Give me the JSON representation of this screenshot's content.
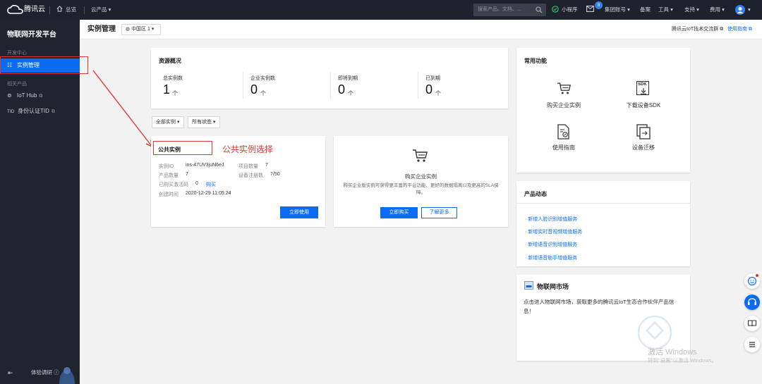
{
  "topbar": {
    "brand": "腾讯云",
    "overview": "总览",
    "products": "云产品",
    "search_placeholder": "搜索产品、文档、...",
    "mini_program": "小程序",
    "msg_badge": "8",
    "group_account": "集团账号",
    "beian": "备案",
    "tools": "工具",
    "support": "支持",
    "billing": "费用"
  },
  "sidebar": {
    "title": "物联网开发平台",
    "group_dev": "开发中心",
    "item_instance": "实例管理",
    "group_related": "相关产品",
    "item_iothub": "IoT Hub",
    "item_tid": "身份认证TID",
    "tid_prefix": "TID",
    "feedback": "体验调研"
  },
  "header": {
    "title": "实例管理",
    "region": "中国区 1",
    "community": "腾讯云IoT技术交流群",
    "guide": "使用指南"
  },
  "overview": {
    "title": "资源概况",
    "stats": [
      {
        "label": "总实例数",
        "value": "1",
        "unit": "个"
      },
      {
        "label": "企业实例数",
        "value": "0",
        "unit": "个"
      },
      {
        "label": "即将到期",
        "value": "0",
        "unit": "个"
      },
      {
        "label": "已到期",
        "value": "0",
        "unit": "个"
      }
    ]
  },
  "filters": {
    "all_instances": "全部实例",
    "all_status": "所有状态"
  },
  "public_instance": {
    "title": "公共实例",
    "id_label": "实例ID",
    "id_value": "ins-47UV3juN6eJ",
    "projects_label": "项目数量",
    "projects_value": "7",
    "products_label": "产品数量",
    "products_value": "7",
    "devices_label": "设备注册数",
    "devices_value": "7/50",
    "purchased_label": "已购买激活码",
    "purchased_value": "0",
    "buy_link": "购买",
    "created_label": "创建时间",
    "created_value": "2020-12-29 11:05:24",
    "use_button": "立即使用"
  },
  "annotation": "公共实例选择",
  "enterprise": {
    "title": "购买企业实例",
    "desc": "购买企业版实例可获得更丰富的平台功能、更好的数据隔离以及更高的SLA保障。",
    "buy_button": "立即购买",
    "more_button": "了解更多"
  },
  "common_functions": {
    "title": "常用功能",
    "items": [
      "购买企业实例",
      "下载设备SDK",
      "使用指南",
      "设备迁移"
    ],
    "sdk_text": "SDK"
  },
  "news": {
    "title": "产品动态",
    "items": [
      "新增人脸识别增值服务",
      "新增实时音视频增值服务",
      "新增语音识别增值服务",
      "新增语音助手增值服务"
    ]
  },
  "market": {
    "title": "物联网市场",
    "desc": "点击进入物联网市场，获取更多的腾讯云IoT生态合作伙伴产品信息！"
  },
  "watermark": {
    "line1": "激活 Windows",
    "line2": "转到\"设置\"以激活 Windows。"
  }
}
